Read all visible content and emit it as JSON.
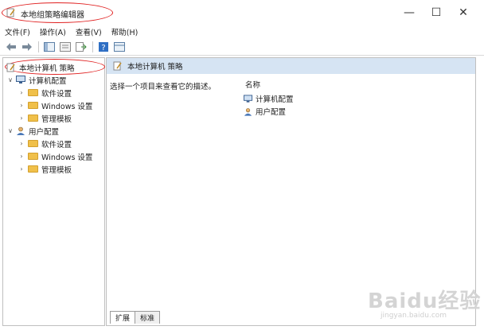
{
  "window": {
    "title": "本地组策略编辑器",
    "minimize_glyph": "—",
    "maximize_glyph": "☐",
    "close_glyph": "✕"
  },
  "menu": [
    "文件(F)",
    "操作(A)",
    "查看(V)",
    "帮助(H)"
  ],
  "toolbar": {
    "icons": [
      "back-icon",
      "forward-icon",
      "show-tree-icon",
      "properties-icon",
      "export-list-icon",
      "help-icon",
      "view-icon"
    ]
  },
  "tree": {
    "root": "本地计算机 策略",
    "computer": {
      "label": "计算机配置",
      "children": [
        "软件设置",
        "Windows 设置",
        "管理模板"
      ]
    },
    "user": {
      "label": "用户配置",
      "children": [
        "软件设置",
        "Windows 设置",
        "管理模板"
      ]
    }
  },
  "main": {
    "header": "本地计算机 策略",
    "description": "选择一个项目来查看它的描述。",
    "column_name": "名称",
    "items": [
      "计算机配置",
      "用户配置"
    ]
  },
  "tabs": [
    "扩展",
    "标准"
  ],
  "watermark": {
    "logo": "Baidu经验",
    "sub": "jingyan.baidu.com"
  },
  "colors": {
    "annotation_red": "#e02020",
    "header_blue": "#d6e4f3",
    "folder_yellow": "#f0c04a"
  }
}
